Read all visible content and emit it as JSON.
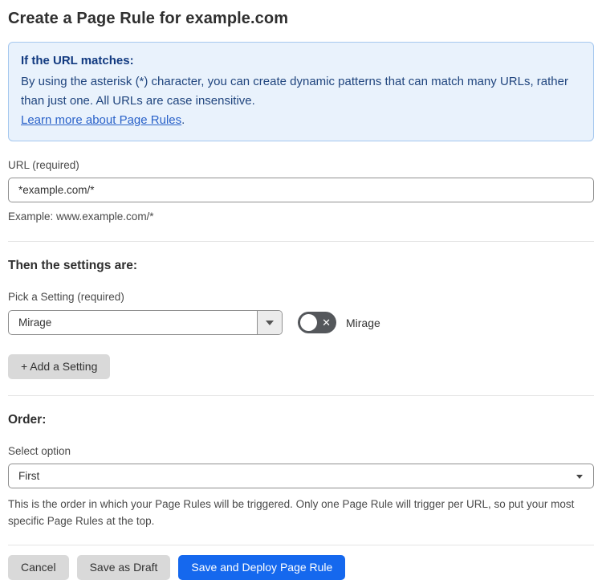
{
  "page": {
    "title": "Create a Page Rule for example.com"
  },
  "colors": {
    "accent_blue": "#1568ee",
    "info_box_bg": "#e9f2fc",
    "info_box_border": "#a6c8ef",
    "info_text": "#20457e",
    "link_blue": "#2a62c9",
    "toggle_off_bg": "#54575b",
    "secondary_button_bg": "#d9d9d9"
  },
  "info_box": {
    "heading": "If the URL matches:",
    "body": "By using the asterisk (*) character, you can create dynamic patterns that can match many URLs, rather than just one. All URLs are case insensitive.",
    "link_label": "Learn more about Page Rules",
    "link_suffix": "."
  },
  "url_field": {
    "label": "URL (required)",
    "value": "*example.com/*",
    "helper": "Example: www.example.com/*"
  },
  "settings_section": {
    "heading": "Then the settings are:",
    "picker_label": "Pick a Setting (required)",
    "picker_value": "Mirage",
    "toggle_label": "Mirage",
    "toggle_state": "off",
    "add_button_label": "+ Add a Setting"
  },
  "order_section": {
    "heading": "Order:",
    "select_label": "Select option",
    "select_value": "First",
    "helper": "This is the order in which your Page Rules will be triggered. Only one Page Rule will trigger per URL, so put your most specific Page Rules at the top."
  },
  "footer": {
    "cancel_label": "Cancel",
    "save_draft_label": "Save as Draft",
    "deploy_label": "Save and Deploy Page Rule"
  }
}
